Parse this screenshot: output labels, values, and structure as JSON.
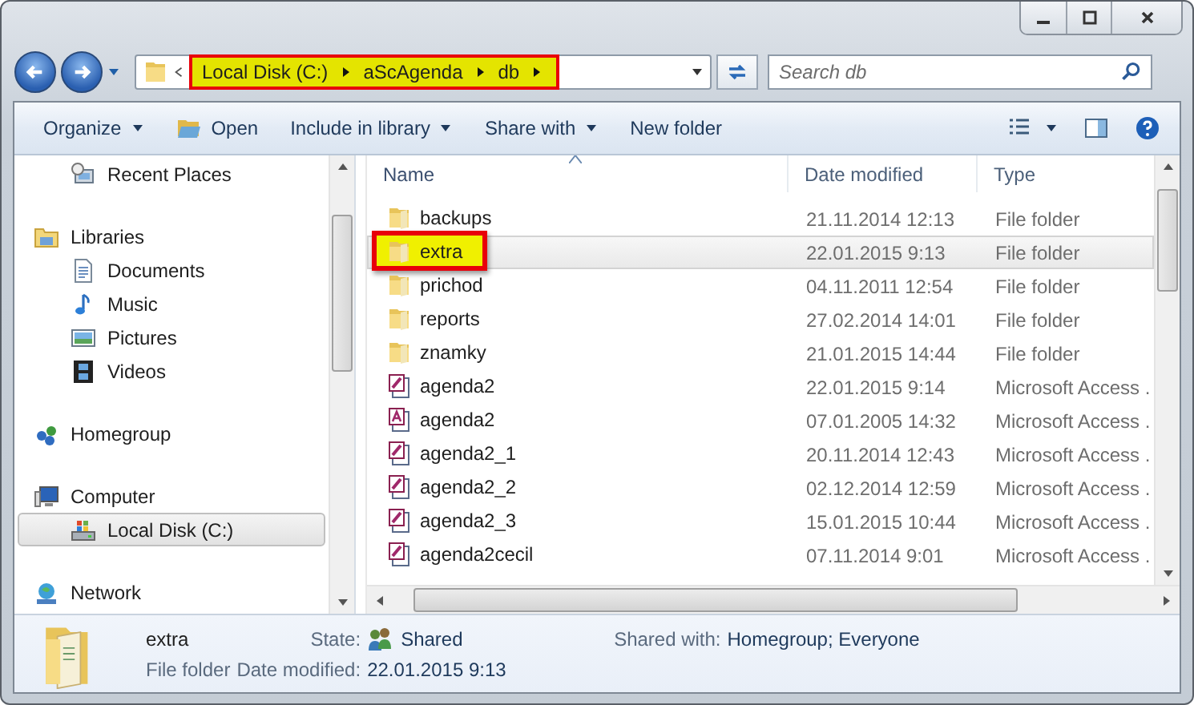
{
  "address_bar": {
    "breadcrumbs": [
      "Local Disk (C:)",
      "aScAgenda",
      "db"
    ],
    "annotated": true
  },
  "search": {
    "placeholder": "Search db"
  },
  "toolbar": {
    "items": [
      {
        "label": "Organize",
        "kind": "menu"
      },
      {
        "label": "Open",
        "kind": "open"
      },
      {
        "label": "Include in library",
        "kind": "menu"
      },
      {
        "label": "Share with",
        "kind": "menu"
      },
      {
        "label": "New folder",
        "kind": "command"
      }
    ]
  },
  "navigation": {
    "groups": [
      {
        "children": [
          {
            "label": "Recent Places",
            "kind": "recent",
            "selected": false
          }
        ]
      },
      {
        "label": "Libraries",
        "kind": "library",
        "children": [
          {
            "label": "Documents",
            "kind": "documents",
            "selected": false
          },
          {
            "label": "Music",
            "kind": "music",
            "selected": false
          },
          {
            "label": "Pictures",
            "kind": "pictures",
            "selected": false
          },
          {
            "label": "Videos",
            "kind": "videos",
            "selected": false
          }
        ]
      },
      {
        "label": "Homegroup",
        "kind": "homegroup"
      },
      {
        "label": "Computer",
        "kind": "computer",
        "children": [
          {
            "label": "Local Disk (C:)",
            "kind": "disk",
            "selected": true
          }
        ]
      },
      {
        "label": "Network",
        "kind": "network"
      }
    ]
  },
  "file_list": {
    "columns": [
      {
        "label": "Name",
        "sorted": true
      },
      {
        "label": "Date modified",
        "sorted": false
      },
      {
        "label": "Type",
        "sorted": false
      }
    ],
    "rows": [
      {
        "name": "backups",
        "date": "21.11.2014 12:13",
        "type": "File folder",
        "kind": "folder",
        "selected": false,
        "annotated": false
      },
      {
        "name": "extra",
        "date": "22.01.2015 9:13",
        "type": "File folder",
        "kind": "folder",
        "selected": true,
        "annotated": true
      },
      {
        "name": "prichod",
        "date": "04.11.2011 12:54",
        "type": "File folder",
        "kind": "folder",
        "selected": false,
        "annotated": false
      },
      {
        "name": "reports",
        "date": "27.02.2014 14:01",
        "type": "File folder",
        "kind": "folder",
        "selected": false,
        "annotated": false
      },
      {
        "name": "znamky",
        "date": "21.01.2015 14:44",
        "type": "File folder",
        "kind": "folder",
        "selected": false,
        "annotated": false
      },
      {
        "name": "agenda2",
        "date": "22.01.2015 9:14",
        "type": "Microsoft Access .",
        "kind": "access",
        "selected": false,
        "annotated": false
      },
      {
        "name": "agenda2",
        "date": "07.01.2005 14:32",
        "type": "Microsoft Access .",
        "kind": "access_legacy",
        "selected": false,
        "annotated": false
      },
      {
        "name": "agenda2_1",
        "date": "20.11.2014 12:43",
        "type": "Microsoft Access .",
        "kind": "access",
        "selected": false,
        "annotated": false
      },
      {
        "name": "agenda2_2",
        "date": "02.12.2014 12:59",
        "type": "Microsoft Access .",
        "kind": "access",
        "selected": false,
        "annotated": false
      },
      {
        "name": "agenda2_3",
        "date": "15.01.2015 10:44",
        "type": "Microsoft Access .",
        "kind": "access",
        "selected": false,
        "annotated": false
      },
      {
        "name": "agenda2cecil",
        "date": "07.11.2014 9:01",
        "type": "Microsoft Access .",
        "kind": "access",
        "selected": false,
        "annotated": false
      }
    ]
  },
  "details": {
    "name": "extra",
    "type": "File folder",
    "fields": [
      {
        "label": "State:",
        "value": "Shared",
        "kind": "state"
      },
      {
        "label": "Shared with:",
        "value": "Homegroup; Everyone",
        "kind": "plain"
      },
      {
        "label": "Date modified:",
        "value": "22.01.2015 9:13",
        "kind": "plain"
      }
    ]
  }
}
